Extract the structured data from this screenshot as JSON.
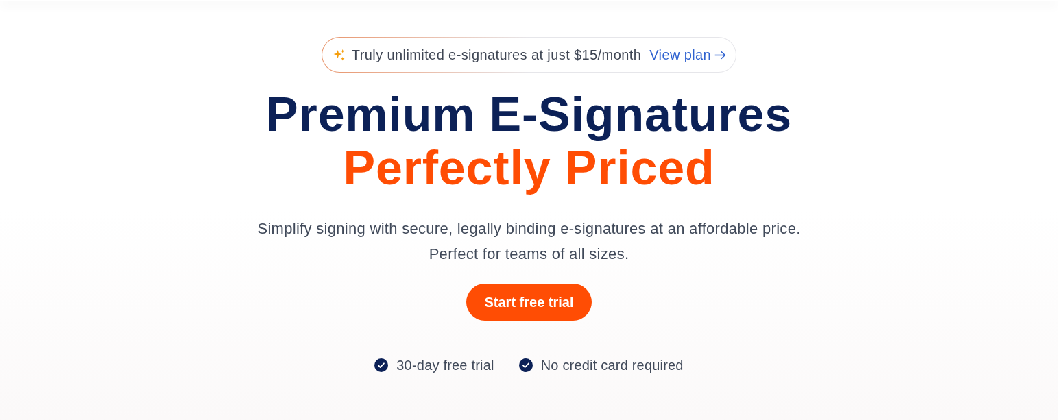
{
  "promo_badge": {
    "text": "Truly unlimited e-signatures at just $15/month",
    "link": "View plan"
  },
  "headline": {
    "line_1": "Premium E-Signatures",
    "line_2": "Perfectly Priced"
  },
  "description": "Simplify signing with secure, legally binding e-signatures at an affordable price. Perfect for teams of all sizes.",
  "cta_button": "Start free trial",
  "features": [
    "30-day free trial",
    "No credit card required"
  ]
}
